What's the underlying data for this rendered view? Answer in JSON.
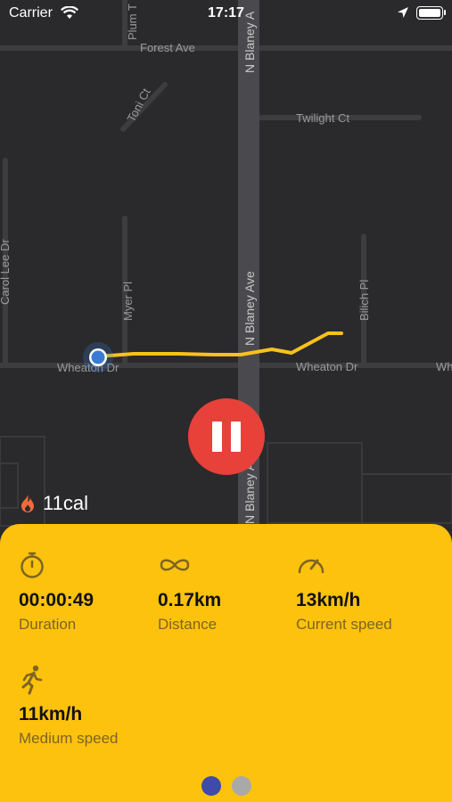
{
  "status_bar": {
    "carrier": "Carrier",
    "time": "17:17",
    "wifi_icon": "wifi-icon",
    "location_icon": "location-arrow-icon",
    "battery_icon": "battery-full-icon"
  },
  "map": {
    "streets": {
      "forest_ave": "Forest Ave",
      "plum_tree": "Plum T",
      "n_blaney_top": "N Blaney A",
      "toni_ct": "Toni Ct",
      "twilight_ct": "Twilight Ct",
      "carol_lee_dr": "Carol Lee Dr",
      "myer_pl": "Myer Pl",
      "n_blaney_mid": "N Blaney Ave",
      "bilich_pl": "Bilich Pl",
      "wheaton_dr_left": "Wheaton Dr",
      "wheaton_dr_right": "Wheaton Dr",
      "wheaton_dr_edge": "Wh",
      "n_blaney_bottom": "N Blaney Ave"
    },
    "route_color": "#f9c21b",
    "position_color": "#3a7bd5"
  },
  "controls": {
    "pause_icon": "pause-icon",
    "pause_color": "#e8413a"
  },
  "calories": {
    "icon": "flame-icon",
    "value": "11cal"
  },
  "stats": [
    {
      "icon": "stopwatch-icon",
      "value": "00:00:49",
      "label": "Duration"
    },
    {
      "icon": "infinity-icon",
      "value": "0.17km",
      "label": "Distance"
    },
    {
      "icon": "speedometer-icon",
      "value": "13km/h",
      "label": "Current speed"
    },
    {
      "icon": "running-person-icon",
      "value": "11km/h",
      "label": "Medium speed"
    }
  ],
  "pager": {
    "active_color": "#3f4ba8",
    "inactive_color": "#a9a9a9"
  },
  "colors": {
    "panel": "#fdc20e",
    "map_background": "#2a2a2c"
  }
}
